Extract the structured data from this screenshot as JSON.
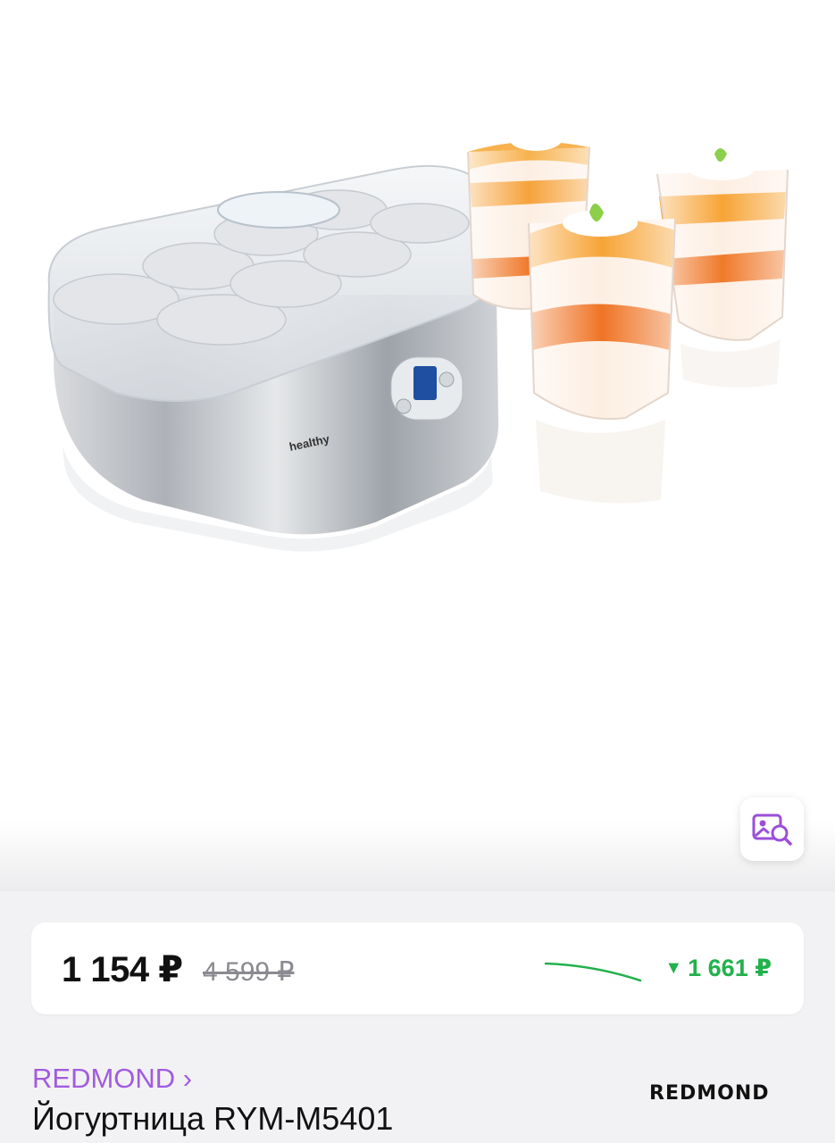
{
  "gallery": {
    "image_search_icon": "image-search-icon"
  },
  "price": {
    "current": "1 154 ₽",
    "old": "4 599 ₽",
    "drop": "1 661 ₽",
    "drop_icon": "down-triangle-icon"
  },
  "product": {
    "brand": "REDMOND ›",
    "title": "Йогуртница RYM-M5401",
    "logo_text": "REDMOND"
  },
  "colors": {
    "brand_link": "#a25be0",
    "price_drop": "#22b14c",
    "background": "#f2f2f4"
  }
}
